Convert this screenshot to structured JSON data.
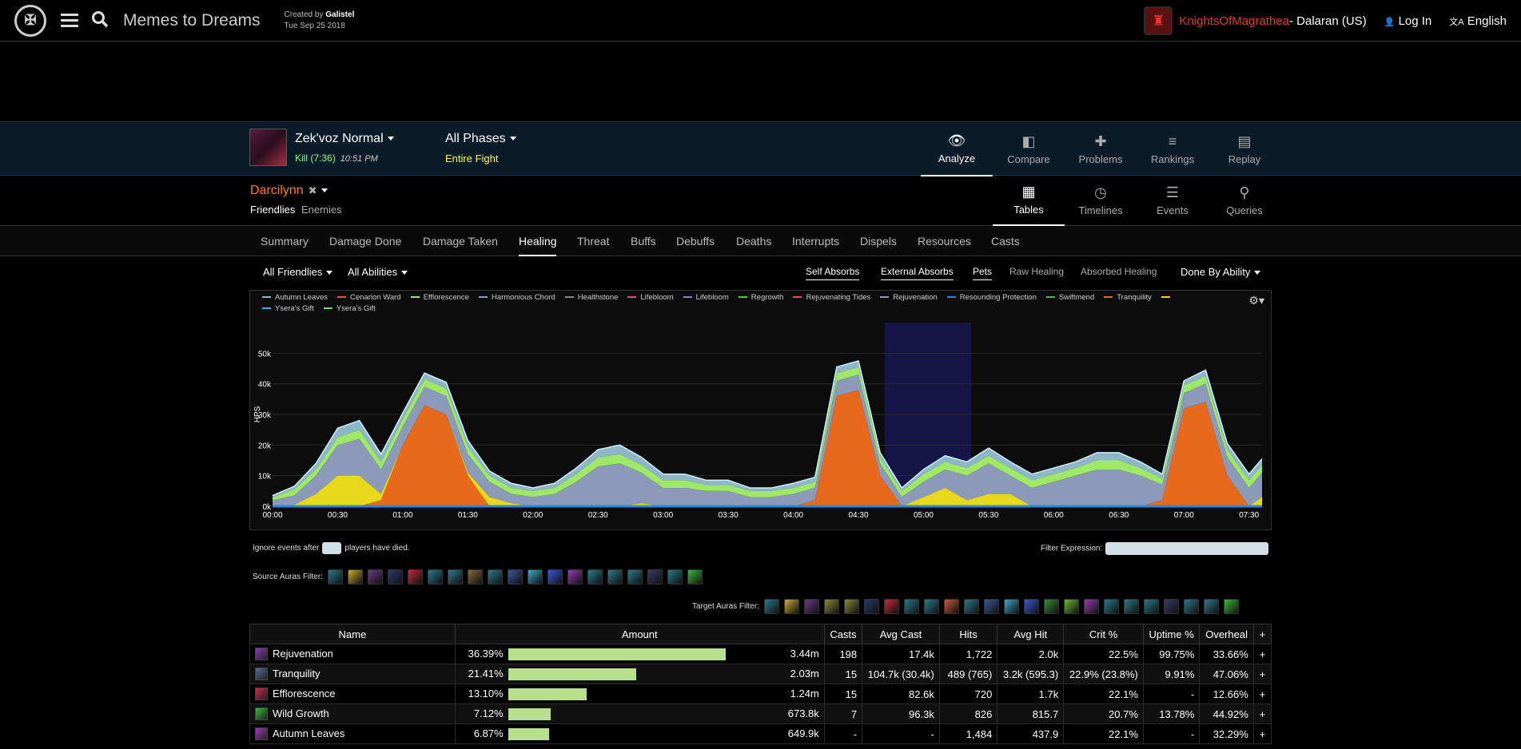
{
  "header": {
    "report_title": "Memes to Dreams",
    "created_by_label": "Created by",
    "created_by": "Galistel",
    "date": "Tue Sep 25 2018",
    "guild": "KnightsOfMagrathea",
    "realm": " - Dalaran (US)",
    "login": "Log In",
    "language": "English"
  },
  "fight": {
    "name": "Zek'voz Normal",
    "result": "Kill (7:36)",
    "time": "10:51 PM",
    "phase": "All Phases",
    "phase_sub": "Entire Fight"
  },
  "mode_nav": [
    {
      "label": "Analyze",
      "icon": "eye-icon",
      "glyph": "👁"
    },
    {
      "label": "Compare",
      "icon": "compare-icon",
      "glyph": "◧"
    },
    {
      "label": "Problems",
      "icon": "puzzle-icon",
      "glyph": "✚"
    },
    {
      "label": "Rankings",
      "icon": "rankings-icon",
      "glyph": "≡"
    },
    {
      "label": "Replay",
      "icon": "film-icon",
      "glyph": "▤"
    }
  ],
  "player": {
    "name": "Darcilynn",
    "friendlies": "Friendlies",
    "enemies": "Enemies"
  },
  "view_nav": [
    {
      "label": "Tables",
      "icon": "table-icon",
      "glyph": "▦"
    },
    {
      "label": "Timelines",
      "icon": "clock-icon",
      "glyph": "◷"
    },
    {
      "label": "Events",
      "icon": "list-icon",
      "glyph": "☰"
    },
    {
      "label": "Queries",
      "icon": "pin-icon",
      "glyph": "⚲"
    }
  ],
  "tabs": [
    "Summary",
    "Damage Done",
    "Damage Taken",
    "Healing",
    "Threat",
    "Buffs",
    "Debuffs",
    "Deaths",
    "Interrupts",
    "Dispels",
    "Resources",
    "Casts"
  ],
  "filters": {
    "friendlies": "All Friendlies",
    "abilities": "All Abilities",
    "self_absorbs": "Self Absorbs",
    "external_absorbs": "External Absorbs",
    "pets": "Pets",
    "raw_healing": "Raw Healing",
    "absorbed_healing": "Absorbed Healing",
    "done_by": "Done By Ability"
  },
  "legend": [
    {
      "name": "Autumn Leaves",
      "color": "#8fb6c8"
    },
    {
      "name": "Cenarion Ward",
      "color": "#e8504a"
    },
    {
      "name": "Efflorescence",
      "color": "#9ee866"
    },
    {
      "name": "Harmonious Chord",
      "color": "#8899cc"
    },
    {
      "name": "Healthstone",
      "color": "#888888"
    },
    {
      "name": "Lifebloom",
      "color": "#e84a7a"
    },
    {
      "name": "Lifebloom",
      "color": "#9a7acc"
    },
    {
      "name": "Regrowth",
      "color": "#4acc4a"
    },
    {
      "name": "Rejuvenating Tides",
      "color": "#e85050"
    },
    {
      "name": "Rejuvenation",
      "color": "#8a9ab8"
    },
    {
      "name": "Resounding Protection",
      "color": "#2a8ad8"
    },
    {
      "name": "Swiftmend",
      "color": "#4ab84a"
    },
    {
      "name": "Tranquility",
      "color": "#e8681c"
    },
    {
      "name": "",
      "color": "#e8d81c"
    },
    {
      "name": "Ysera's Gift",
      "color": "#2ab8e8"
    },
    {
      "name": "Ysera's Gift",
      "color": "#66e866"
    }
  ],
  "chart_data": {
    "type": "area",
    "ylabel": "HPS",
    "ylim": [
      0,
      60000
    ],
    "yticks": [
      "0k",
      "10k",
      "20k",
      "30k",
      "40k",
      "50k"
    ],
    "xticks": [
      "00:00",
      "00:30",
      "01:00",
      "01:30",
      "02:00",
      "02:30",
      "03:00",
      "03:30",
      "04:00",
      "04:30",
      "05:00",
      "05:30",
      "06:00",
      "06:30",
      "07:00",
      "07:30"
    ],
    "highlight_range": [
      "04:42",
      "05:22"
    ],
    "x_seconds": [
      0,
      10,
      20,
      30,
      40,
      50,
      60,
      70,
      80,
      90,
      100,
      110,
      120,
      130,
      140,
      150,
      160,
      170,
      180,
      190,
      200,
      210,
      220,
      230,
      240,
      250,
      260,
      270,
      280,
      290,
      300,
      310,
      320,
      330,
      340,
      350,
      360,
      370,
      380,
      390,
      400,
      410,
      420,
      430,
      440,
      450,
      456
    ],
    "series": [
      {
        "name": "Tranquility",
        "color": "#e8681c",
        "values": [
          0,
          0,
          0,
          0,
          0,
          2000,
          20000,
          33000,
          30000,
          10000,
          0,
          0,
          0,
          0,
          0,
          0,
          0,
          0,
          0,
          0,
          0,
          0,
          0,
          0,
          0,
          2000,
          36000,
          38000,
          10000,
          0,
          0,
          0,
          0,
          0,
          0,
          0,
          0,
          0,
          0,
          0,
          0,
          2000,
          32000,
          34000,
          10000,
          0,
          0
        ]
      },
      {
        "name": "Yellow",
        "color": "#e8d81c",
        "values": [
          0,
          500,
          4000,
          10000,
          10000,
          2000,
          0,
          0,
          0,
          1000,
          3000,
          1000,
          0,
          0,
          0,
          0,
          0,
          1000,
          0,
          0,
          0,
          0,
          0,
          0,
          0,
          0,
          0,
          0,
          0,
          0,
          3000,
          6000,
          2000,
          4000,
          4000,
          0,
          0,
          0,
          0,
          0,
          0,
          0,
          0,
          0,
          0,
          0,
          3000,
          8000,
          3000,
          0
        ]
      },
      {
        "name": "Rejuvenation",
        "color": "#8a9ab8",
        "values": [
          2000,
          3000,
          6000,
          10000,
          12000,
          8000,
          6000,
          6000,
          6000,
          6000,
          5000,
          3000,
          3000,
          4000,
          8000,
          13000,
          14000,
          10000,
          6000,
          6000,
          5000,
          5000,
          3000,
          3000,
          4000,
          4000,
          5000,
          5000,
          4000,
          3000,
          5000,
          6000,
          8000,
          10000,
          6000,
          6000,
          8000,
          10000,
          12000,
          12000,
          10000,
          5000,
          5000,
          6000,
          6000,
          6000,
          8000,
          12000,
          12000,
          8000
        ]
      },
      {
        "name": "Efflorescence",
        "color": "#9ee866",
        "values": [
          1000,
          2000,
          2000,
          2500,
          3000,
          2500,
          2500,
          2500,
          2500,
          2500,
          2000,
          2000,
          2000,
          2000,
          2500,
          3000,
          3000,
          2500,
          2500,
          2500,
          2000,
          2000,
          2000,
          2000,
          2000,
          2000,
          2500,
          2500,
          2000,
          2000,
          2500,
          2500,
          2500,
          2500,
          2500,
          2500,
          2500,
          2500,
          3000,
          3000,
          2500,
          2000,
          2500,
          2500,
          2500,
          2500,
          2500,
          3000,
          3000,
          2500
        ]
      },
      {
        "name": "Autumn Leaves",
        "color": "#8fb6c8",
        "values": [
          500,
          1000,
          2000,
          3000,
          3000,
          2500,
          2000,
          2000,
          2000,
          2000,
          1500,
          1500,
          1000,
          1500,
          2000,
          2500,
          3000,
          2500,
          2000,
          2000,
          1500,
          1500,
          1000,
          1000,
          1500,
          1500,
          2000,
          2000,
          1500,
          1000,
          1500,
          2000,
          2000,
          2500,
          2000,
          2000,
          2000,
          2000,
          2500,
          2500,
          2000,
          1500,
          1500,
          2000,
          2000,
          2000,
          2000,
          2500,
          2500,
          2000
        ]
      }
    ]
  },
  "ignore_label_pre": "Ignore events after",
  "ignore_label_post": "players have died.",
  "filter_expression_label": "Filter Expression:",
  "source_auras_label": "Source Auras Filter:",
  "target_auras_label": "Target Auras Filter:",
  "source_aura_colors": [
    "#2a7a8a",
    "#c8a838",
    "#6a3a8a",
    "#2a3a6a",
    "#c82a3a",
    "#2a7a8a",
    "#2a7a8a",
    "#8a6a3a",
    "#2a7a8a",
    "#3a5a9a",
    "#3aa8c8",
    "#3a5ad8",
    "#9a3ab8",
    "#2a7a8a",
    "#2a7a8a",
    "#2a7a8a",
    "#3a3a6a",
    "#2a7a8a",
    "#3ab83a"
  ],
  "target_aura_colors": [
    "#2a7a8a",
    "#c8a838",
    "#6a3a8a",
    "#8a8a3a",
    "#8a8a3a",
    "#2a3a6a",
    "#c82a3a",
    "#2a7a8a",
    "#2a7a8a",
    "#c85a3a",
    "#2a7a8a",
    "#3a5a9a",
    "#3aa8c8",
    "#3a5ad8",
    "#3a8a3a",
    "#6ab83a",
    "#9a3ab8",
    "#2a7a8a",
    "#2a7a8a",
    "#2a7a8a",
    "#3a3a6a",
    "#2a7a8a",
    "#2a7a8a",
    "#3ab83a"
  ],
  "table": {
    "columns": [
      "Name",
      "Amount",
      "Casts",
      "Avg Cast",
      "Hits",
      "Avg Hit",
      "Crit %",
      "Uptime %",
      "Overheal",
      "+"
    ],
    "rows": [
      {
        "name": "Rejuvenation",
        "icon_color": "#8a3ab8",
        "pct": "36.39%",
        "bar": 1.0,
        "amount": "3.44m",
        "casts": "198",
        "avg_cast": "17.4k",
        "hits": "1,722",
        "avg_hit": "2.0k",
        "crit": "22.5%",
        "uptime": "99.75%",
        "overheal": "33.66%"
      },
      {
        "name": "Tranquility",
        "icon_color": "#5a6a9a",
        "pct": "21.41%",
        "bar": 0.588,
        "amount": "2.03m",
        "casts": "15",
        "avg_cast": "104.7k (30.4k)",
        "hits": "489 (765)",
        "avg_hit": "3.2k (595.3)",
        "crit": "22.9% (23.8%)",
        "uptime": "9.91%",
        "overheal": "47.06%"
      },
      {
        "name": "Efflorescence",
        "icon_color": "#c82a4a",
        "pct": "13.10%",
        "bar": 0.36,
        "amount": "1.24m",
        "casts": "15",
        "avg_cast": "82.6k",
        "hits": "720",
        "avg_hit": "1.7k",
        "crit": "22.1%",
        "uptime": "-",
        "overheal": "12.66%"
      },
      {
        "name": "Wild Growth",
        "icon_color": "#3ab83a",
        "pct": "7.12%",
        "bar": 0.196,
        "amount": "673.8k",
        "casts": "7",
        "avg_cast": "96.3k",
        "hits": "826",
        "avg_hit": "815.7",
        "crit": "20.7%",
        "uptime": "13.78%",
        "overheal": "44.92%"
      },
      {
        "name": "Autumn Leaves",
        "icon_color": "#9a3ab8",
        "pct": "6.87%",
        "bar": 0.189,
        "amount": "649.9k",
        "casts": "-",
        "avg_cast": "-",
        "hits": "1,484",
        "avg_hit": "437.9",
        "crit": "22.1%",
        "uptime": "-",
        "overheal": "32.29%"
      }
    ]
  }
}
